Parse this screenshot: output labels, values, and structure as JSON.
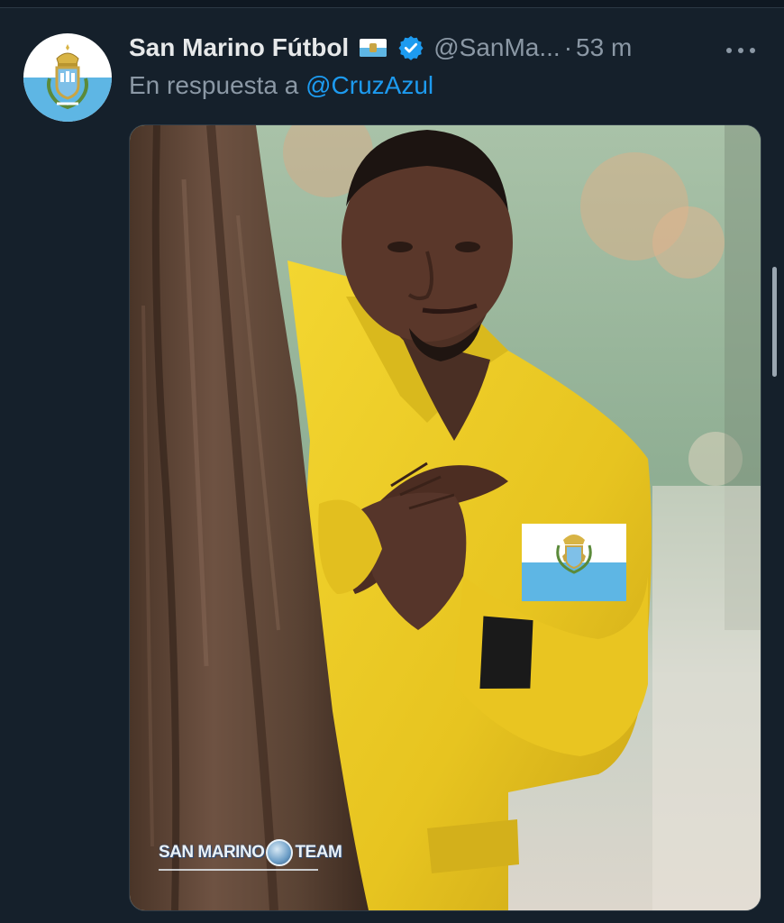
{
  "tweet": {
    "author": {
      "display_name": "San Marino Fútbol",
      "handle": "@SanMa...",
      "flag_icon": "san-marino-flag-emoji",
      "verified_icon": "verified-badge-icon"
    },
    "separator": "·",
    "time": "53 m",
    "reply_prefix": "En respuesta a",
    "reply_mention": "@CruzAzul",
    "more_icon": "more-options-icon",
    "media": {
      "description_icon": "meme-photo",
      "watermark_left": "SAN MARINO",
      "watermark_right": "TEAM",
      "sticker": "san-marino-flag-sticker"
    }
  },
  "colors": {
    "background": "#15202b",
    "primary_text": "#e7e9ea",
    "secondary_text": "#8b98a5",
    "link": "#1d9bf0",
    "verified": "#1d9bf0",
    "flag_white": "#ffffff",
    "flag_blue": "#5eb6e4"
  }
}
